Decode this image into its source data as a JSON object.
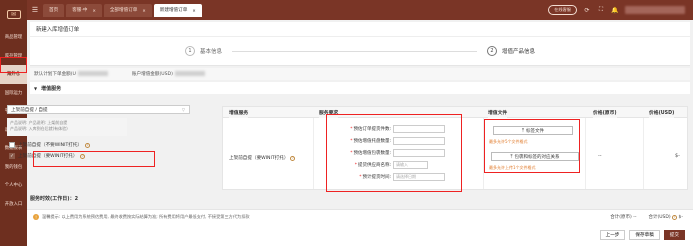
{
  "sidebar": {
    "logo": "✉",
    "items": [
      {
        "label": "商品管理"
      },
      {
        "label": "库存管理"
      },
      {
        "label": "海外仓"
      },
      {
        "label": "国际运力"
      },
      {
        "label": "平台同步"
      },
      {
        "label": "退货管理"
      },
      {
        "label": "数据报表"
      },
      {
        "label": "我的钱包"
      },
      {
        "label": "个人中心"
      },
      {
        "label": "开放入口"
      }
    ]
  },
  "topbar": {
    "tabs": [
      {
        "label": "首页"
      },
      {
        "label": "客服·中"
      },
      {
        "label": "全部增值订单"
      },
      {
        "label": "新建增值订单"
      }
    ],
    "pill": "在线客服"
  },
  "page": {
    "title": "新建入库增值订单",
    "steps": [
      {
        "num": "1",
        "label": "基本信息"
      },
      {
        "num": "2",
        "label": "增值产品信息"
      }
    ],
    "stats": {
      "left": "默认计划下单金额(U",
      "right": "账户增值金额(USD)"
    },
    "section_title": "增值服务"
  },
  "left_panel": {
    "select_value": "上架前自提 / 自提",
    "hint_lines": [
      "产品说明: 产品说明: 上架前自提",
      "产品说明: 入库到仓后就(有体验)"
    ],
    "options": [
      {
        "label": "上架前自提（不要WINIT打托）",
        "checked": false
      },
      {
        "label": "上架前自提（要WINIT打托）",
        "checked": true
      }
    ]
  },
  "table": {
    "headers": {
      "service": "增值服务",
      "requirement": "服务要求",
      "files": "增值文件",
      "price": "价格(原币)",
      "price_usd": "价格(USD)"
    },
    "row": {
      "service_name": "上架前自提（要WINIT打托）",
      "fields": [
        {
          "label": "预估订单提货件数:",
          "placeholder": "",
          "required": true
        },
        {
          "label": "预估增值托盘数量:",
          "placeholder": "",
          "required": true
        },
        {
          "label": "预估增值包裹数量:",
          "placeholder": "",
          "required": true
        },
        {
          "label": "提货供应商名称:",
          "placeholder": "请输入",
          "required": true
        },
        {
          "label": "预计提货时间:",
          "placeholder": "请选择日期",
          "required": true
        }
      ],
      "upload_label": "标签文件",
      "upload_link": "最多允许5个文件格式",
      "relation_label": "包裹和标签的对应关系",
      "relation_link": "最多允许上传1个文件格式",
      "price": "--",
      "price_usd": "$-"
    }
  },
  "timeline": "服务时效(工作日)：2",
  "footer": {
    "notice": "温馨提示: 以上费用为系统预估费用, 最终收费按实际结算为准; 所有费用将用户最低支付, 不接受第三方代为扣款",
    "total_label": "合计(原币)",
    "total_value": "--",
    "total_usd_label": "合计(USD)",
    "total_usd_value": "$-",
    "prev": "上一步",
    "draft": "保存草稿",
    "submit": "提交"
  }
}
